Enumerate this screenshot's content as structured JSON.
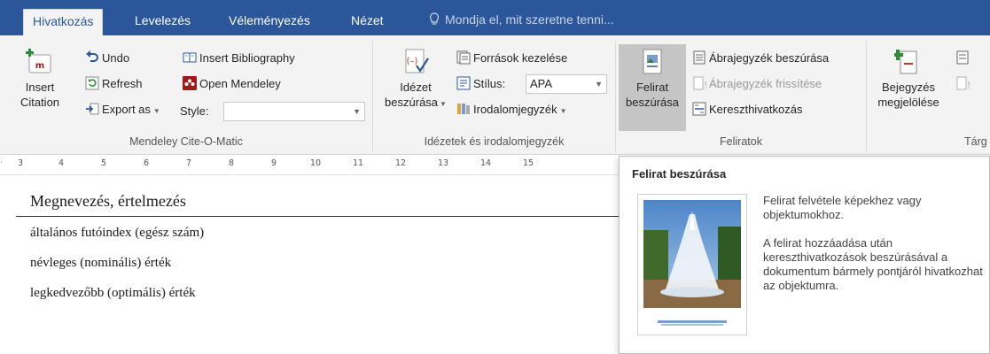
{
  "tabs": [
    {
      "label": "Hivatkozás",
      "active": true
    },
    {
      "label": "Levelezés",
      "active": false
    },
    {
      "label": "Véleményezés",
      "active": false
    },
    {
      "label": "Nézet",
      "active": false
    }
  ],
  "tell_me": {
    "text": "Mondja el, mit szeretne tenni..."
  },
  "mendeley": {
    "insert_citation": [
      "Insert",
      "Citation"
    ],
    "undo": "Undo",
    "refresh": "Refresh",
    "export_as": "Export as",
    "insert_bibliography": "Insert Bibliography",
    "open_mendeley": "Open Mendeley",
    "style_label": "Style:",
    "style_value": "",
    "group_label": "Mendeley Cite-O-Matic"
  },
  "citations": {
    "insert_citation": [
      "Idézet",
      "beszúrása"
    ],
    "manage_sources": "Források kezelése",
    "style_label": "Stílus:",
    "style_value": "APA",
    "bibliography": "Irodalomjegyzék",
    "group_label": "Idézetek és irodalomjegyzék"
  },
  "captions": {
    "insert_caption": [
      "Felirat",
      "beszúrása"
    ],
    "insert_table_of_figures": "Ábrajegyzék beszúrása",
    "update_table": "Ábrajegyzék frissítése",
    "cross_reference": "Kereszthivatkozás",
    "group_label": "Feliratok"
  },
  "index": {
    "mark_entry": [
      "Bejegyzés",
      "megjelölése"
    ],
    "group_label": "Tárg"
  },
  "ruler": [
    "3",
    "4",
    "5",
    "6",
    "7",
    "8",
    "9",
    "10",
    "11",
    "12",
    "13",
    "14",
    "15"
  ],
  "document": {
    "heading": "Megnevezés, értelmezés",
    "lines": [
      "általános futóindex (egész szám)",
      "névleges (nominális) érték",
      "legkedvezőbb (optimális) érték"
    ]
  },
  "tooltip": {
    "title": "Felirat beszúrása",
    "paragraph1": "Felirat felvétele képekhez vagy objektumokhoz.",
    "paragraph2": "A felirat hozzáadása után kereszthivatkozások beszúrásával a dokumentum bármely pontjáról hivatkozhat az objektumra."
  },
  "colors": {
    "accent": "#2b579a",
    "ribbon_bg": "#f3f3f3",
    "selected_button": "#c5c5c5"
  }
}
